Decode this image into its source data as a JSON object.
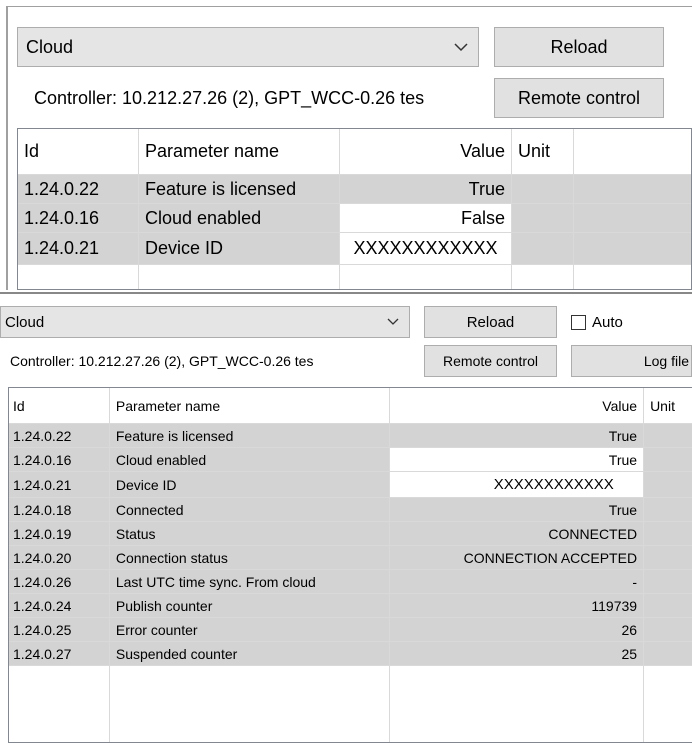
{
  "top_panel": {
    "combo_value": "Cloud",
    "reload_label": "Reload",
    "controller_text": "Controller: 10.212.27.26 (2), GPT_WCC-0.26 tes",
    "remote_control_label": "Remote control",
    "columns": [
      "Id",
      "Parameter name",
      "Value",
      "Unit"
    ],
    "rows": [
      {
        "id": "1.24.0.22",
        "name": "Feature is licensed",
        "value": "True",
        "unit": ""
      },
      {
        "id": "1.24.0.16",
        "name": "Cloud enabled",
        "value": "False",
        "unit": ""
      },
      {
        "id": "1.24.0.21",
        "name": "Device ID",
        "value": "XXXXXXXXXXXX",
        "unit": ""
      }
    ]
  },
  "bottom_panel": {
    "combo_value": "Cloud",
    "reload_label": "Reload",
    "auto_label": "Auto",
    "auto_checked": false,
    "controller_text": "Controller: 10.212.27.26 (2), GPT_WCC-0.26 tes",
    "remote_control_label": "Remote control",
    "log_file_label": "Log file",
    "columns": [
      "Id",
      "Parameter name",
      "Value",
      "Unit"
    ],
    "rows": [
      {
        "id": "1.24.0.22",
        "name": "Feature is licensed",
        "value": "True",
        "unit": ""
      },
      {
        "id": "1.24.0.16",
        "name": "Cloud enabled",
        "value": "True",
        "unit": ""
      },
      {
        "id": "1.24.0.21",
        "name": "Device ID",
        "value": "XXXXXXXXXXXX",
        "unit": ""
      },
      {
        "id": "1.24.0.18",
        "name": "Connected",
        "value": "True",
        "unit": ""
      },
      {
        "id": "1.24.0.19",
        "name": "Status",
        "value": "CONNECTED",
        "unit": ""
      },
      {
        "id": "1.24.0.20",
        "name": "Connection status",
        "value": "CONNECTION ACCEPTED",
        "unit": ""
      },
      {
        "id": "1.24.0.26",
        "name": "Last UTC time sync. From cloud",
        "value": "-",
        "unit": ""
      },
      {
        "id": "1.24.0.24",
        "name": "Publish counter",
        "value": "119739",
        "unit": ""
      },
      {
        "id": "1.24.0.25",
        "name": "Error counter",
        "value": "26",
        "unit": ""
      },
      {
        "id": "1.24.0.27",
        "name": "Suspended counter",
        "value": "25",
        "unit": ""
      }
    ]
  },
  "icons": {
    "dropdown": "chevron-down-icon",
    "checkbox": "checkbox-icon"
  }
}
